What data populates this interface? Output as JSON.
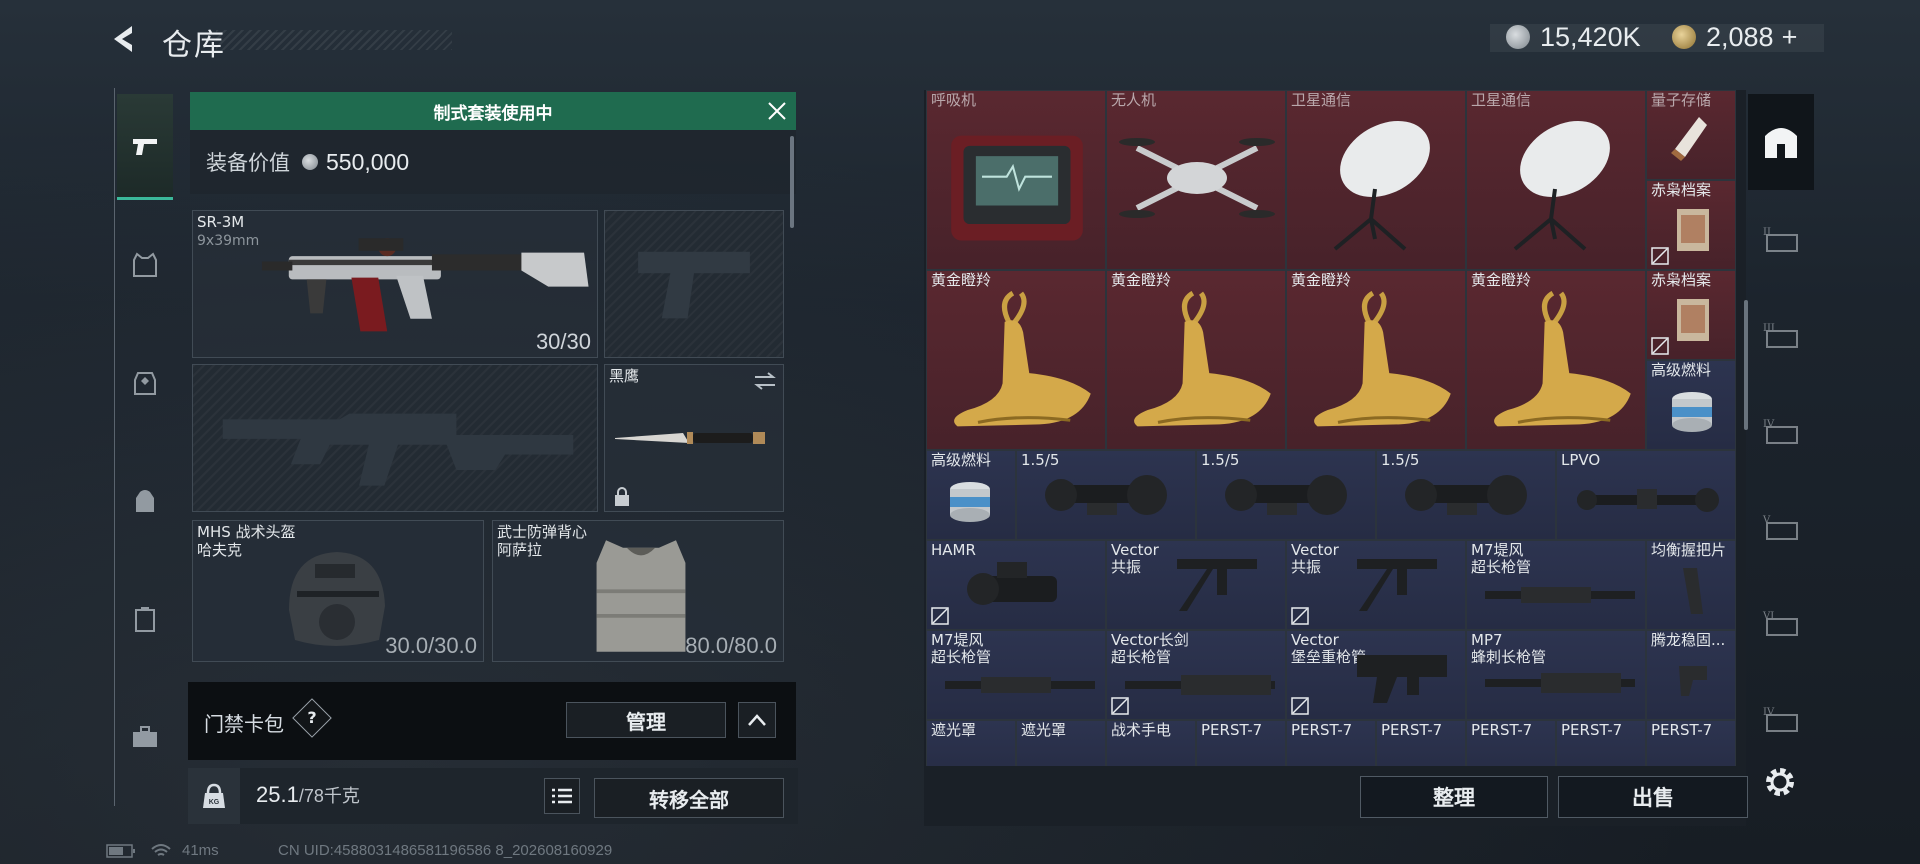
{
  "header": {
    "title": "仓库",
    "currency_silver": "15,420K",
    "currency_gold": "2,088",
    "currency_add": "+"
  },
  "left_rail": {
    "items": [
      {
        "icon": "pistol-icon",
        "active": true
      },
      {
        "icon": "armor-vest-icon"
      },
      {
        "icon": "chest-rig-icon"
      },
      {
        "icon": "backpack-icon"
      },
      {
        "icon": "case-icon"
      },
      {
        "icon": "toolbox-icon"
      }
    ]
  },
  "loadout": {
    "banner": "制式套装使用中",
    "value_label": "装备价值",
    "value": "550,000",
    "primary": {
      "name": "SR-3M",
      "caliber": "9x39mm",
      "ammo": "30/30"
    },
    "melee": {
      "name": "黑鹰"
    },
    "helmet": {
      "name": "MHS 战术头盔",
      "sub": "哈夫克",
      "durability": "30.0/30.0"
    },
    "vest": {
      "name": "武士防弹背心",
      "sub": "阿萨拉",
      "durability": "80.0/80.0"
    },
    "keycard_label": "门禁卡包",
    "keycard_help": "?",
    "manage_button": "管理",
    "weight_value": "25.1",
    "weight_max": "/78千克",
    "transfer_all_button": "转移全部"
  },
  "status": {
    "ping": "41ms",
    "uid": "CN UID:4588031486581196586 8_202608160929"
  },
  "stash": {
    "row1": [
      "呼吸机",
      "无人机",
      "卫星通信",
      "卫星通信",
      "量子存储"
    ],
    "row1_side": "赤枭档案",
    "row2": [
      "黄金瞪羚",
      "黄金瞪羚",
      "黄金瞪羚",
      "黄金瞪羚"
    ],
    "row2_side": [
      "赤枭档案",
      "高级燃料"
    ],
    "row3": [
      "高级燃料",
      "1.5/5",
      "1.5/5",
      "1.5/5",
      "LPVO"
    ],
    "row4": [
      {
        "name": "HAMR",
        "sub": ""
      },
      {
        "name": "Vector",
        "sub": "共振"
      },
      {
        "name": "Vector",
        "sub": "共振"
      },
      {
        "name": "M7堤风",
        "sub": "超长枪管"
      },
      {
        "name": "均衡握把片",
        "sub": ""
      }
    ],
    "row5": [
      {
        "name": "M7堤风",
        "sub": "超长枪管"
      },
      {
        "name": "Vector长剑",
        "sub": "超长枪管"
      },
      {
        "name": "Vector",
        "sub": "堡垒重枪管"
      },
      {
        "name": "MP7",
        "sub": "蜂刺长枪管"
      },
      {
        "name": "腾龙稳固...",
        "sub": ""
      }
    ],
    "row6": [
      "遮光罩",
      "遮光罩",
      "战术手电",
      "PERST-7",
      "PERST-7",
      "PERST-7",
      "PERST-7",
      "PERST-7",
      "PERST-7"
    ],
    "sort_button": "整理",
    "sell_button": "出售"
  },
  "right_rail": {
    "items": [
      "stash-home-icon",
      "stash-tab-2-icon",
      "stash-tab-3-icon",
      "stash-tab-4-icon",
      "stash-tab-5-icon",
      "stash-tab-6-icon",
      "stash-tab-7-icon"
    ],
    "tab_numerals": [
      "",
      "II",
      "III",
      "IV",
      "V",
      "VI"
    ]
  },
  "colors": {
    "accent_green": "#1f6b4f",
    "rare_red": "#5a2830",
    "epic_blue": "#2d3450"
  }
}
